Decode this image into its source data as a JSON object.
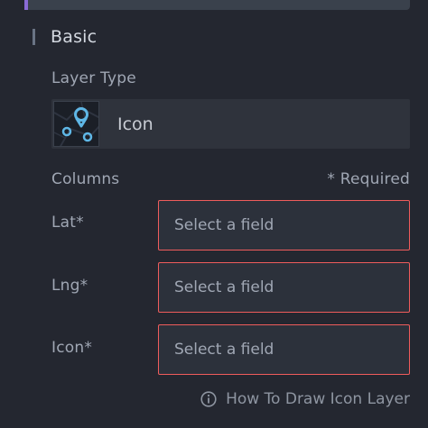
{
  "section": {
    "title": "Basic"
  },
  "layer_type": {
    "label": "Layer Type",
    "value": "Icon",
    "icon": "icon-layer-thumbnail"
  },
  "columns": {
    "label": "Columns",
    "required_note": "* Required",
    "fields": [
      {
        "label": "Lat*",
        "placeholder": "Select a field"
      },
      {
        "label": "Lng*",
        "placeholder": "Select a field"
      },
      {
        "label": "Icon*",
        "placeholder": "Select a field"
      }
    ]
  },
  "help": {
    "text": "How To Draw Icon Layer",
    "icon": "info-icon"
  },
  "colors": {
    "background": "#242730",
    "error_border": "#f05c5c",
    "accent": "#8a6bd6",
    "icon_blue": "#5fb7e6"
  }
}
